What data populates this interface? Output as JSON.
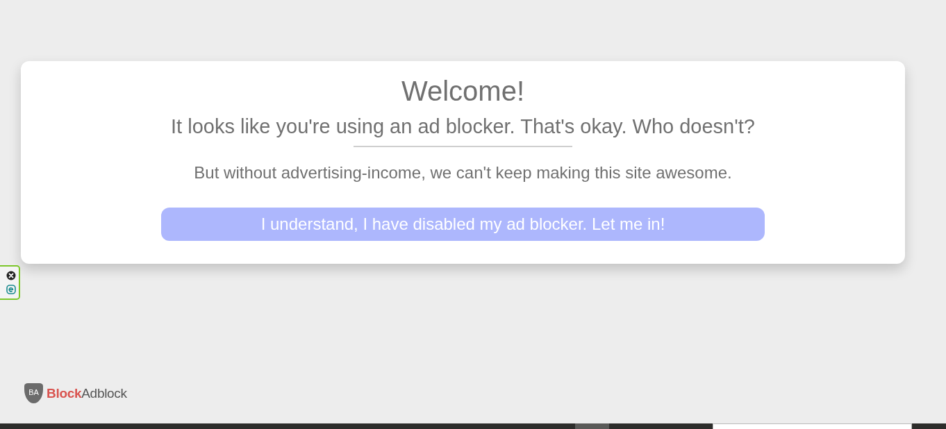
{
  "dialog": {
    "title": "Welcome!",
    "subtitle": "It looks like you're using an ad blocker. That's okay. Who doesn't?",
    "message": "But without advertising-income, we can't keep making this site awesome.",
    "button": "I understand, I have disabled my ad blocker. Let me in!"
  },
  "logo": {
    "badge": "BA",
    "parts": [
      {
        "text": "Block",
        "kind": "accent"
      },
      {
        "text": "Adblock",
        "kind": "plain"
      }
    ]
  }
}
